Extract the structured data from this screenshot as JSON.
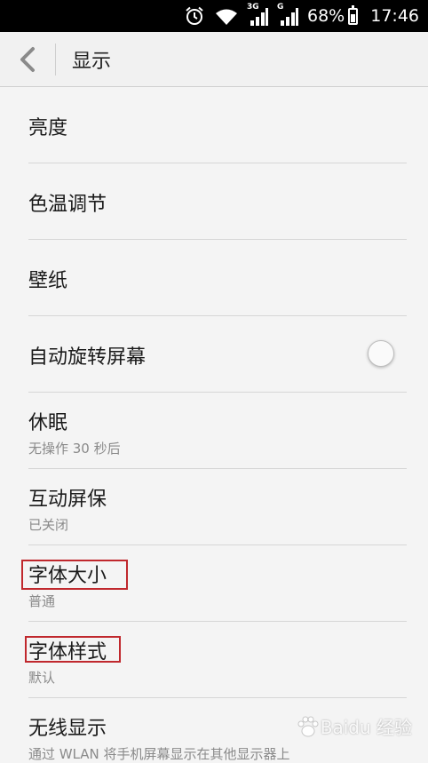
{
  "status_bar": {
    "net1": "3G",
    "net2": "G",
    "battery_percent": "68%",
    "battery_level": 0.68,
    "time": "17:46"
  },
  "header": {
    "title": "显示",
    "back_icon": "chevron-left-icon"
  },
  "settings": [
    {
      "title": "亮度"
    },
    {
      "title": "色温调节"
    },
    {
      "title": "壁纸"
    },
    {
      "title": "自动旋转屏幕",
      "toggle": false
    },
    {
      "title": "休眠",
      "subtitle": "无操作 30 秒后"
    },
    {
      "title": "互动屏保",
      "subtitle": "已关闭"
    },
    {
      "title": "字体大小",
      "subtitle": "普通",
      "highlighted": true
    },
    {
      "title": "字体样式",
      "subtitle": "默认",
      "highlighted": true
    },
    {
      "title": "无线显示",
      "subtitle": "通过 WLAN 将手机屏幕显示在其他显示器上"
    }
  ],
  "watermark": {
    "text": "Baidu 经验",
    "logo_icon": "paw-icon"
  },
  "colors": {
    "highlight": "#c0282d",
    "background": "#f4f4f4",
    "status_bar": "#000000"
  }
}
